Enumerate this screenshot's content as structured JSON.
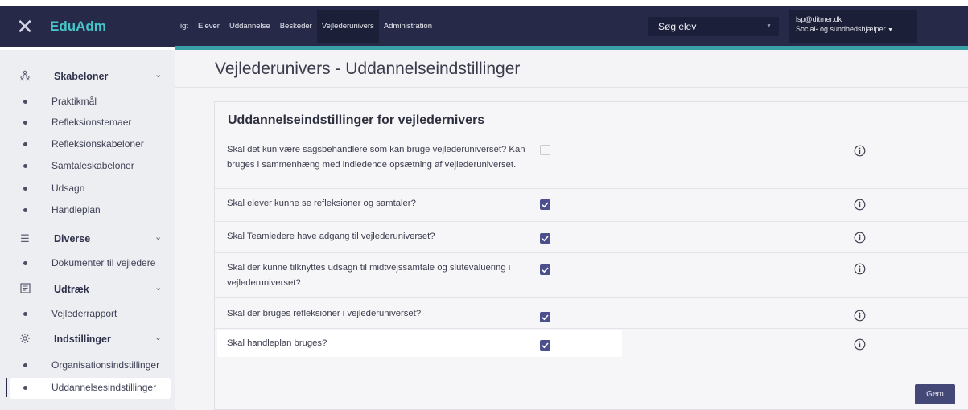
{
  "app": {
    "brand": "EduAdm",
    "close_icon": "close-icon"
  },
  "nav": {
    "items": [
      "igt",
      "Elever",
      "Uddannelse",
      "Beskeder",
      "Vejlederunivers",
      "Administration"
    ],
    "active": "Vejlederunivers"
  },
  "search": {
    "label": "Søg elev"
  },
  "user": {
    "email": "lsp@ditmer.dk",
    "role": "Social- og sundhedshjælper"
  },
  "sidebar": {
    "groups": [
      {
        "label": "Skabeloner",
        "icon": "people-icon",
        "items": [
          "Praktikmål",
          "Refleksionstemaer",
          "Refleksionskabeloner",
          "Samtaleskabeloner",
          "Udsagn",
          "Handleplan"
        ]
      },
      {
        "label": "Diverse",
        "icon": "list-icon",
        "items": [
          "Dokumenter til vejledere"
        ]
      },
      {
        "label": "Udtræk",
        "icon": "report-icon",
        "items": [
          "Vejlederrapport"
        ]
      },
      {
        "label": "Indstillinger",
        "icon": "settings-icon",
        "items": [
          "Organisationsindstillinger",
          "Uddannelsesindstillinger"
        ]
      }
    ],
    "active_item": "Uddannelsesindstillinger"
  },
  "page": {
    "title": "Vejlederunivers - Uddannelseindstillinger"
  },
  "card": {
    "title": "Uddannelseindstillinger for vejledernivers",
    "rows": [
      {
        "question": "Skal det kun være sagsbehandlere som kan bruge vejlederuniverset? Kan bruges i sammenhæng med indledende opsætning af vejlederuniverset.",
        "checked": false
      },
      {
        "question": "Skal elever kunne se refleksioner og samtaler?",
        "checked": true
      },
      {
        "question": "Skal Teamledere have adgang til vejlederuniverset?",
        "checked": true
      },
      {
        "question": "Skal der kunne tilknyttes udsagn til midtvejssamtale og slutevaluering i vejlederuniverset?",
        "checked": true
      },
      {
        "question": "Skal der bruges refleksioner i vejlederuniverset?",
        "checked": true
      },
      {
        "question": "Skal handleplan bruges?",
        "checked": true
      }
    ],
    "save_label": "Gem"
  },
  "colors": {
    "topbar": "#262a48",
    "accent": "#3aa0a8",
    "brand": "#46c4c8",
    "checkbox": "#4b4f8c",
    "save_button": "#444877"
  }
}
